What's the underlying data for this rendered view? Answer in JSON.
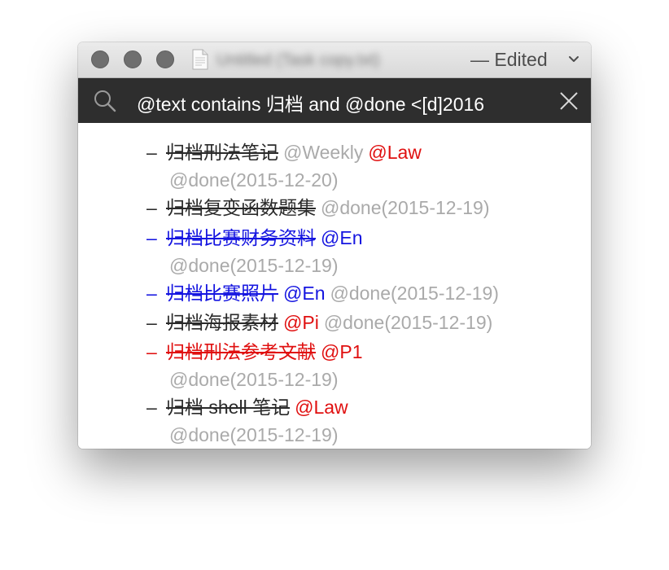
{
  "window": {
    "title": "Untitled (Task copy.txt)",
    "status": "— Edited"
  },
  "search": {
    "query": "@text contains 归档 and @done <[d]2016"
  },
  "colors": {
    "black": "#2a2a2a",
    "blue": "#1515e0",
    "red": "#e01010",
    "gray": "#aaaaaa"
  },
  "items": [
    {
      "dash": "–",
      "text": "归档刑法笔记",
      "tag1": "@Weekly",
      "tag2": "@Law",
      "done": "@done(2015-12-20)"
    },
    {
      "dash": "–",
      "text": "归档复变函数题集",
      "done": "@done(2015-12-19)"
    },
    {
      "dash": "–",
      "text": "归档比赛财务资料",
      "tag1": "@En",
      "done": "@done(2015-12-19)"
    },
    {
      "dash": "–",
      "text": "归档比赛照片",
      "tag1": "@En",
      "done": "@done(2015-12-19)"
    },
    {
      "dash": "–",
      "text": "归档海报素材",
      "tag1": "@Pi",
      "done": "@done(2015-12-19)"
    },
    {
      "dash": "–",
      "text": "归档刑法参考文献",
      "tag1": "@P1",
      "done": "@done(2015-12-19)"
    },
    {
      "dash": "–",
      "text": "归档 shell 笔记",
      "tag1": "@Law",
      "done": "@done(2015-12-19)"
    }
  ]
}
